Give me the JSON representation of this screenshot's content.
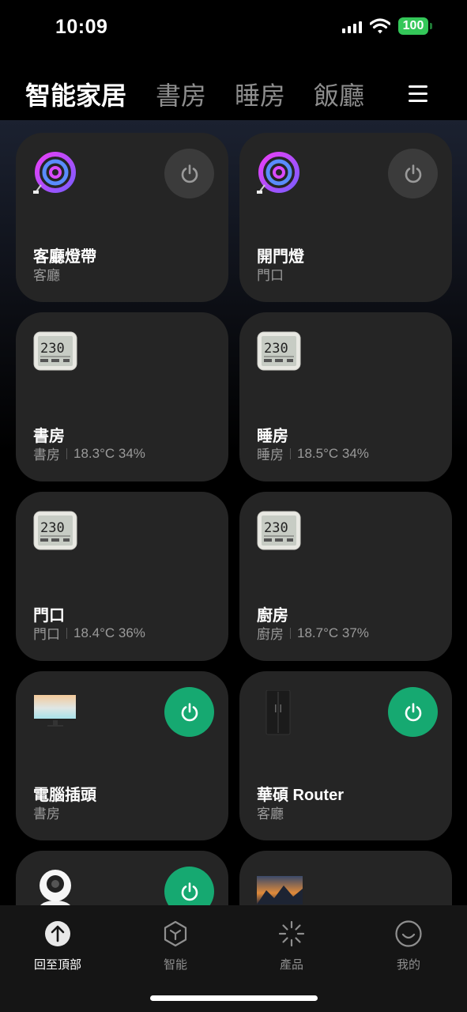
{
  "status_bar": {
    "time": "10:09",
    "battery": "100"
  },
  "header": {
    "tabs": [
      {
        "label": "智能家居",
        "active": true
      },
      {
        "label": "書房",
        "active": false
      },
      {
        "label": "睡房",
        "active": false
      },
      {
        "label": "飯廳",
        "active": false
      }
    ]
  },
  "devices": [
    {
      "name": "客廳燈帶",
      "room": "客廳",
      "icon": "light-strip-icon",
      "power": "off"
    },
    {
      "name": "開門燈",
      "room": "門口",
      "icon": "light-strip-icon",
      "power": "off"
    },
    {
      "name": "書房",
      "room": "書房",
      "reading": "18.3°C 34%",
      "icon": "thermometer-hygrometer-icon",
      "display": "230"
    },
    {
      "name": "睡房",
      "room": "睡房",
      "reading": "18.5°C 34%",
      "icon": "thermometer-hygrometer-icon",
      "display": "230"
    },
    {
      "name": "門口",
      "room": "門口",
      "reading": "18.4°C 36%",
      "icon": "thermometer-hygrometer-icon",
      "display": "230"
    },
    {
      "name": "廚房",
      "room": "廚房",
      "reading": "18.7°C 37%",
      "icon": "thermometer-hygrometer-icon",
      "display": "230"
    },
    {
      "name": "電腦插頭",
      "room": "書房",
      "icon": "monitor-icon",
      "power": "on"
    },
    {
      "name": "華碩 Router",
      "room": "客廳",
      "icon": "refrigerator-icon",
      "power": "on"
    },
    {
      "icon": "security-camera-icon",
      "power": "on"
    },
    {
      "icon": "landscape-thumbnail-icon"
    }
  ],
  "bottom_nav": [
    {
      "label": "回至頂部",
      "icon": "arrow-up-circle-icon",
      "active": true
    },
    {
      "label": "智能",
      "icon": "hexagon-cube-icon",
      "active": false
    },
    {
      "label": "產品",
      "icon": "loader-icon",
      "active": false
    },
    {
      "label": "我的",
      "icon": "smiley-face-icon",
      "active": false
    }
  ],
  "colors": {
    "power_on": "#16a971",
    "power_off": "#3b3b3b",
    "card_bg": "#252525",
    "battery": "#34c759"
  }
}
